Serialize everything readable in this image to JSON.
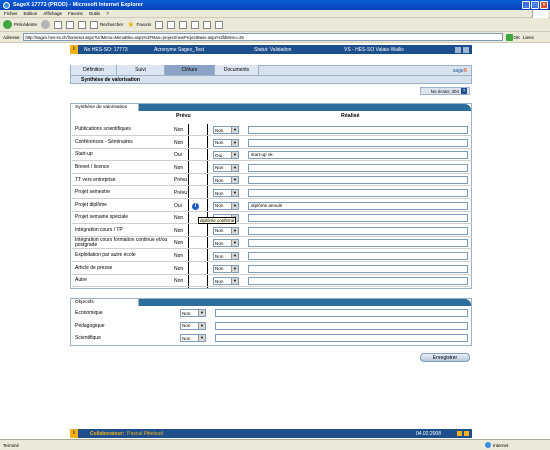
{
  "window": {
    "title": "SageX 17773 (PROD) - Microsoft Internet Explorer"
  },
  "menu": [
    "Fichier",
    "Edition",
    "Affichage",
    "Favoris",
    "Outils",
    "?"
  ],
  "toolbar": {
    "back": "Précédente",
    "search": "Rechercher",
    "favorites": "Favoris"
  },
  "address": {
    "label": "Adresse",
    "url": "http://sagex.hes-so.ch/frameset.aspx?UrlMenu=MenuBleu.aspx%3FMan=project/newProjectBase.aspx%3fdMenu=29",
    "go": "OK",
    "links": "Liens"
  },
  "topinfo": {
    "nr": "No HES-SO: 17773",
    "acronyme": "Acronyme Sagex_Test",
    "statut": "Statut: Validation",
    "vs": "VS - HES-SO Valais-Wallis"
  },
  "tabs": [
    "Définition",
    "Suivi",
    "Clôture",
    "Documents"
  ],
  "brand": {
    "text": "sage",
    "x": "X"
  },
  "subheader": "Synthèse de valorisation",
  "ecran": {
    "label": "No écran: 304",
    "help": "?"
  },
  "valorisation": {
    "section_title": "Synthèse de valorisation",
    "col_prevu": "Prévu",
    "col_realise": "Réalisé",
    "rows": [
      {
        "name": "Publications scientifiques",
        "prevu": "Non",
        "info": "",
        "realise": "Non",
        "text": ""
      },
      {
        "name": "Conférences - Séminaires",
        "prevu": "Non",
        "info": "",
        "realise": "Non",
        "text": ""
      },
      {
        "name": "Start-up",
        "prevu": "Oui",
        "info": "",
        "realise": "Oui",
        "text": "start-up ok"
      },
      {
        "name": "Brevet / licence",
        "prevu": "Non",
        "info": "",
        "realise": "Non",
        "text": ""
      },
      {
        "name": "TT vers entreprise",
        "prevu": "Prévu",
        "info": "",
        "realise": "Non",
        "text": ""
      },
      {
        "name": "Projet semestre",
        "prevu": "Prévu",
        "info": "",
        "realise": "Non",
        "text": ""
      },
      {
        "name": "Projet diplôme",
        "prevu": "Oui",
        "info": "i",
        "realise": "Non",
        "text": "diplôme annulé"
      },
      {
        "name": "Projet semaine spéciale",
        "prevu": "Non",
        "info": "",
        "realise": "Non",
        "text": ""
      },
      {
        "name": "Intégration cours / TP",
        "prevu": "Non",
        "info": "",
        "realise": "Non",
        "text": ""
      },
      {
        "name": "Intégration cours formation continue et/ou postgrade",
        "prevu": "Non",
        "info": "",
        "realise": "Non",
        "text": ""
      },
      {
        "name": "Exploitation par autre école",
        "prevu": "Non",
        "info": "",
        "realise": "Non",
        "text": ""
      },
      {
        "name": "Article de presse",
        "prevu": "Non",
        "info": "",
        "realise": "Non",
        "text": ""
      },
      {
        "name": "Autre",
        "prevu": "Non",
        "info": "",
        "realise": "Non",
        "text": ""
      }
    ],
    "tooltip": "diplôme confirmé"
  },
  "objectifs": {
    "section_title": "Objectifs",
    "rows": [
      {
        "name": "Economique",
        "value": "Non"
      },
      {
        "name": "Pédagogique",
        "value": "Non"
      },
      {
        "name": "Scientifique",
        "value": "Non"
      }
    ]
  },
  "save_label": "Enregistrer",
  "footer": {
    "collab_label": "Collaborateur:",
    "collab_name": "Pascal Pitteloud",
    "date": "04.02.2008"
  },
  "status": {
    "left": "Terminé",
    "zone": "Internet"
  }
}
